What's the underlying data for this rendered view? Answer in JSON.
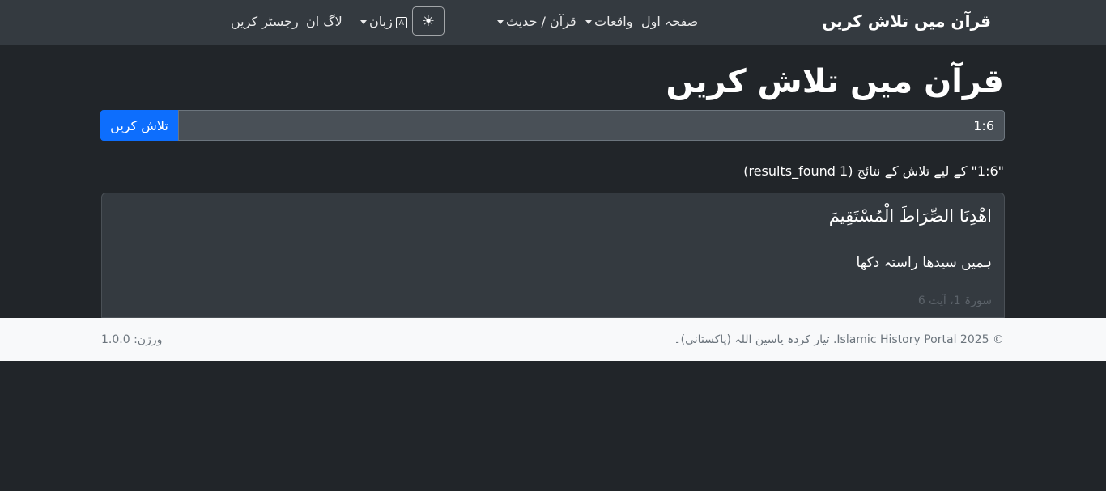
{
  "navbar": {
    "brand": "قرآن میں تلاش کریں",
    "home": "صفحہ اول",
    "events": "واقعات",
    "quran_hadith": "قرآن / حدیث",
    "theme_icon": "sun-icon",
    "language": "زبان",
    "login": "لاگ ان",
    "register": "رجسٹر کریں"
  },
  "page": {
    "title": "قرآن میں تلاش کریں"
  },
  "search": {
    "value": "1:6",
    "button_label": "تلاش کریں"
  },
  "results": {
    "summary": "\"1:6\" کے لیے تلاش کے نتائج (1 results_found)",
    "items": [
      {
        "arabic": "اهْدِنَا الصِّرَاطَ الْمُسْتَقِيمَ",
        "translation": "ہمیں سیدھا راستہ دکھا",
        "reference": "سورۃ 1، آیت 6"
      }
    ]
  },
  "footer": {
    "copyright": "© 2025 Islamic History Portal. تیار کردہ یاسین اللہ (پاکستانی)۔",
    "version": "ورژن: 1.0.0"
  },
  "colors": {
    "background": "#212529",
    "navbar": "#343a40",
    "primary": "#0d6efd",
    "footer": "#f8f9fa"
  }
}
